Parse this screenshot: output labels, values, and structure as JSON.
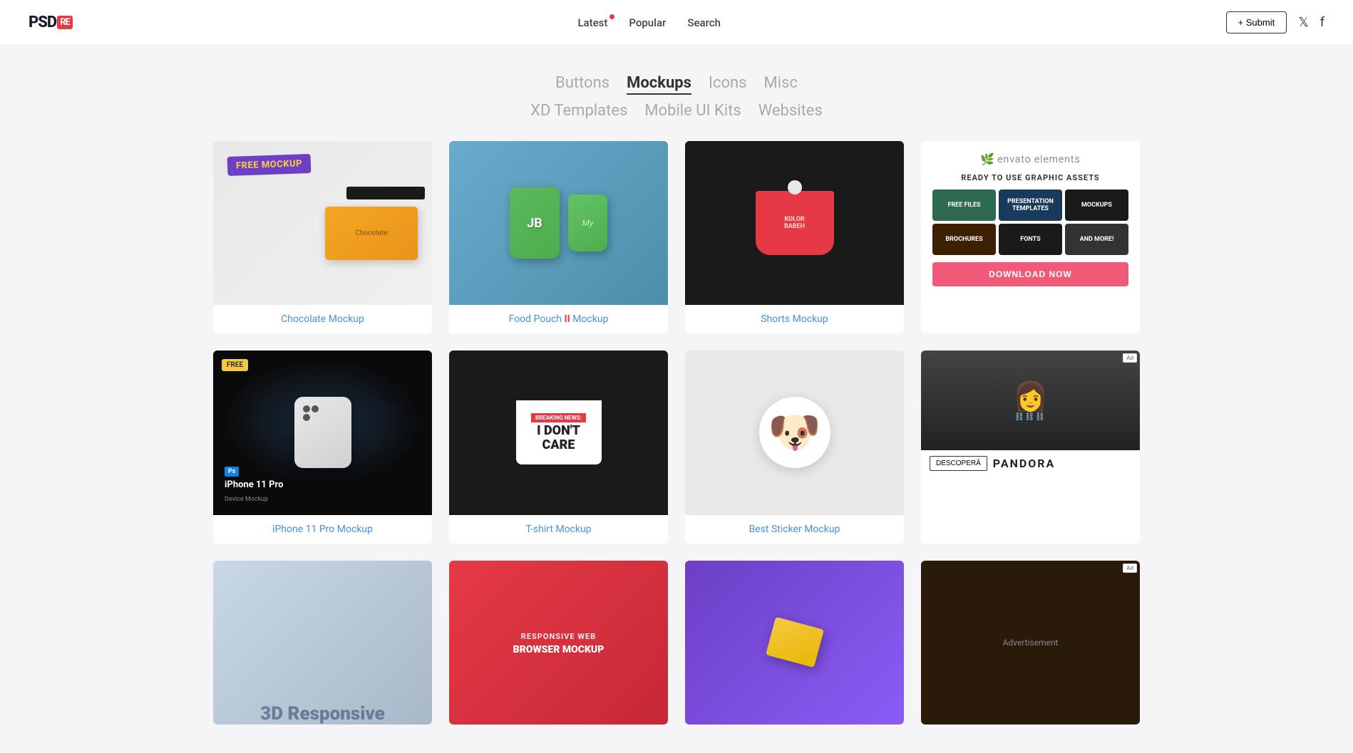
{
  "header": {
    "logo_psd": "PSD",
    "logo_re": "RE",
    "nav": [
      {
        "label": "Latest",
        "has_dot": true
      },
      {
        "label": "Popular",
        "has_dot": false
      },
      {
        "label": "Search",
        "has_dot": false
      }
    ],
    "submit_label": "+ Submit",
    "twitter_label": "𝕏",
    "facebook_label": "f"
  },
  "categories": {
    "row1": [
      {
        "label": "Buttons",
        "active": false
      },
      {
        "label": "Mockups",
        "active": true
      },
      {
        "label": "Icons",
        "active": false
      },
      {
        "label": "Misc",
        "active": false
      }
    ],
    "row2": [
      {
        "label": "XD Templates",
        "active": false
      },
      {
        "label": "Mobile UI Kits",
        "active": false
      },
      {
        "label": "Websites",
        "active": false
      }
    ]
  },
  "grid_row1": [
    {
      "id": "chocolate",
      "badge": "FREE MOCKUP",
      "title_link": "Chocolate Mockup",
      "title_plain": "",
      "link_color": "#4a90d9"
    },
    {
      "id": "food-pouch",
      "badge": "",
      "title_link_part1": "Food Pouch",
      "title_link_part2": "II",
      "title_link_part3": " Mockup",
      "title_plain": "",
      "link_color": "#4a90d9"
    },
    {
      "id": "shorts",
      "badge": "",
      "title_plain": "Shorts Mockup",
      "link_color": "#4a90d9"
    }
  ],
  "grid_row2": [
    {
      "id": "iphone",
      "badge": "FREE",
      "title_link_part1": "iPhone 11 Pro",
      "title_link_part2": " Mockup"
    },
    {
      "id": "tshirt",
      "badge": "",
      "title_link": "T-shirt Mockup"
    },
    {
      "id": "sticker",
      "badge": "",
      "title_plain": "Best Sticker Mockup"
    }
  ],
  "envato": {
    "tagline": "READY TO USE GRAPHIC ASSETS",
    "tiles": [
      {
        "label": "FREE FILES",
        "color": "#2d6a4f"
      },
      {
        "label": "PRESENTATION TEMPLATES",
        "color": "#1a3a5c"
      },
      {
        "label": "MOCKUPS",
        "color": "#1a1a1a"
      },
      {
        "label": "BROCHURES",
        "color": "#3d2000"
      },
      {
        "label": "FONTS",
        "color": "#1a1a1a"
      },
      {
        "label": "AND MORE!",
        "color": "#1a1a1a"
      }
    ],
    "download_label": "DOWNLOAD NOW"
  },
  "iphone_card": {
    "ps_label": "Ps",
    "title": "iPhone 11 Pro",
    "subtitle": "Device Mockup"
  },
  "tshirt_card": {
    "breaking": "BREAKING NEWS:",
    "dont_care": "I DON'T\nCARE"
  },
  "bottom_row": [
    {
      "id": "3d-responsive",
      "label": "3D Responsive",
      "title": "3D Responsive"
    },
    {
      "id": "browser-mockup",
      "label": "Responsive Web Browser Mockup",
      "label1": "RESPONSIVE WEB",
      "label2": "BROWSER MOCKUP"
    },
    {
      "id": "purple-mockup",
      "label": ""
    }
  ]
}
